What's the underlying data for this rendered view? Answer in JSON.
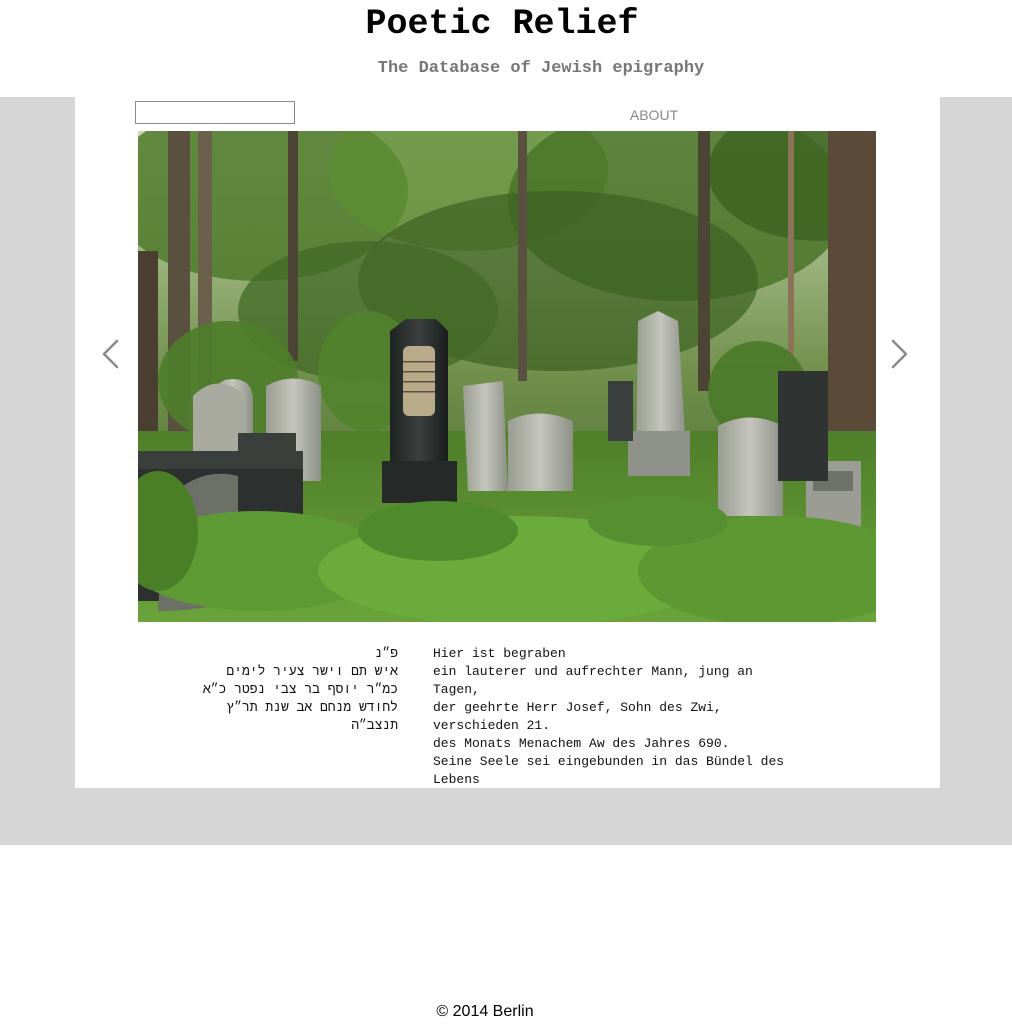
{
  "header": {
    "title": "Poetic Relief",
    "subtitle": "The Database of Jewish epigraphy"
  },
  "nav": {
    "search_value": "",
    "about_label": "ABOUT"
  },
  "carousel": {
    "prev_icon": "chevron-left-icon",
    "next_icon": "chevron-right-icon",
    "image": "jewish-cemetery-overgrown-tombstones-photo"
  },
  "inscription": {
    "hebrew": "פ״נ\nאיש תם וישר צעיר לימים\nכמ״ר יוסף בר צבי נפטר כ״א\nלחודש מנחם אב שנת תר״ץ\nתנצב״ה",
    "german": "Hier ist begraben\nein lauterer und aufrechter Mann, jung an Tagen,\nder geehrte Herr Josef, Sohn des Zwi, verschieden 21.\ndes Monats Menachem Aw des Jahres 690.\nSeine Seele sei eingebunden in das Bündel des Lebens"
  },
  "footer": {
    "text": "© 2014 Berlin"
  },
  "colors": {
    "band": "#d6d6d6",
    "subtitle": "#777777",
    "nav_link": "#888888",
    "arrow": "#8a8a8a"
  }
}
